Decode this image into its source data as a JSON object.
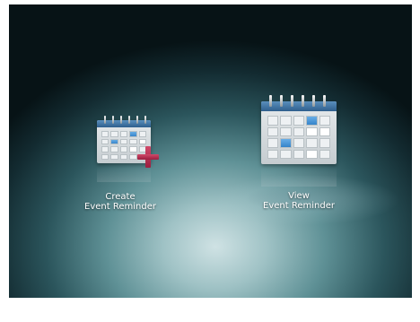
{
  "menu": {
    "items": [
      {
        "id": "create",
        "line1": "Create",
        "line2": "Event Reminder",
        "icon": "calendar-add-icon"
      },
      {
        "id": "view",
        "line1": "View",
        "line2": "Event Reminder",
        "icon": "calendar-icon"
      }
    ]
  },
  "colors": {
    "accent_blue": "#2f7fc6",
    "plus_red": "#b02a4c",
    "label": "#ffffff"
  }
}
